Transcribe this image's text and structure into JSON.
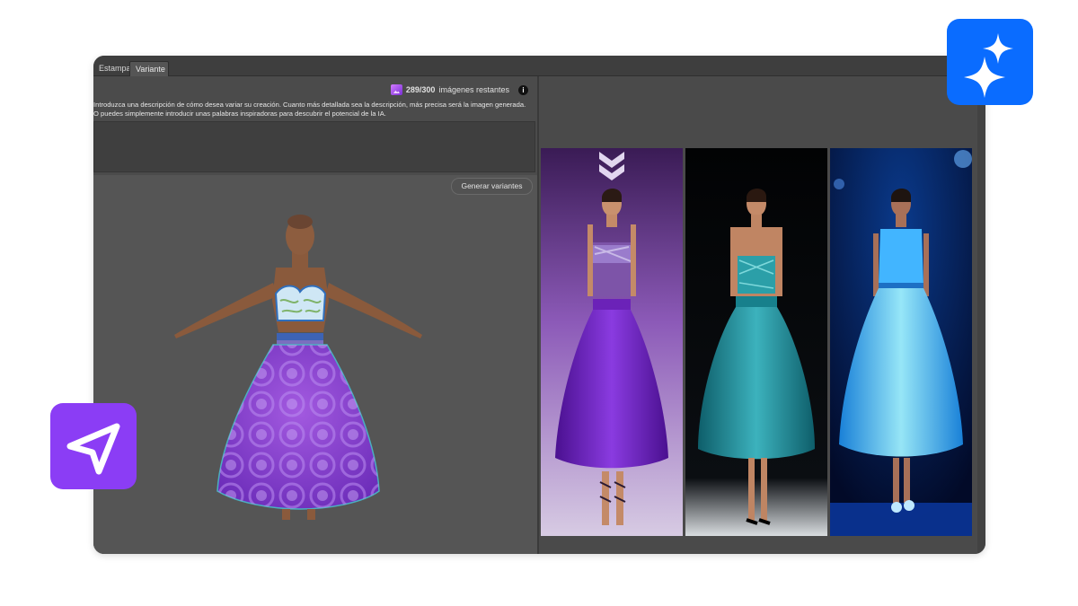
{
  "tabs": [
    {
      "label": "Estampa",
      "active": false
    },
    {
      "label": "Variante",
      "active": true
    }
  ],
  "counter": {
    "count": "289/300",
    "suffix": "imágenes restantes",
    "info_glyph": "i",
    "icon": "image-gallery-icon"
  },
  "instructions": {
    "line1": "Introduzca una descripción de cómo desea variar su creación. Cuanto más detallada sea la descripción, más precisa será la imagen generada.",
    "line2": "O puedes simplemente introducir unas palabras inspiradoras para descubrir el potencial de la IA."
  },
  "description_input": {
    "value": "",
    "placeholder": ""
  },
  "generate_button": {
    "label": "Generar variantes"
  },
  "variants": [
    {
      "dress": "purple",
      "top_color": "#7b4fb0",
      "skirt_color": "#6a1fb5",
      "bg": "purple-runway"
    },
    {
      "dress": "teal",
      "top_color": "#2aa0a8",
      "skirt_color": "#1c8f9c",
      "bg": "dark-runway"
    },
    {
      "dress": "glowing-blue",
      "top_color": "#3ab8ff",
      "skirt_color": "#48c9ff",
      "bg": "blue-runway"
    }
  ],
  "colors": {
    "sparkle_badge": "#0a6cff",
    "send_badge": "#8b3df5",
    "app_background": "#4a4a4a"
  },
  "icons": {
    "sparkle_badge": "sparkle-icon",
    "send_badge": "send-icon"
  }
}
